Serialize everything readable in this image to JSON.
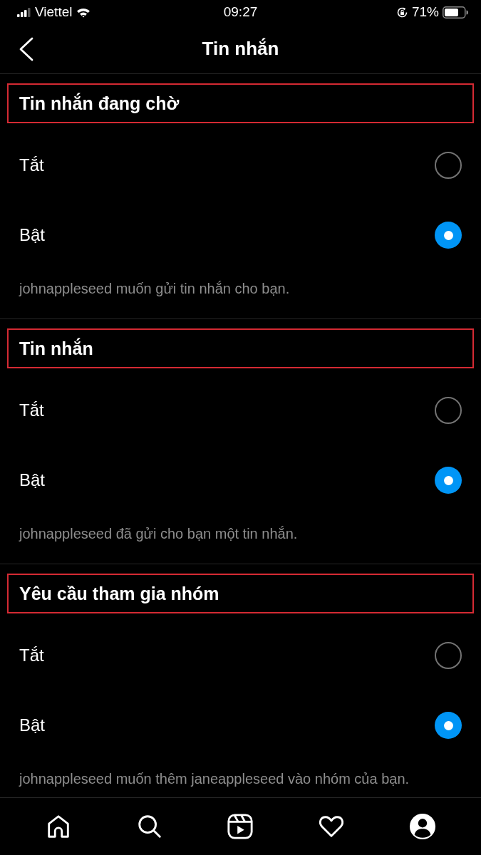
{
  "status_bar": {
    "carrier": "Viettel",
    "time": "09:27",
    "battery": "71%"
  },
  "header": {
    "title": "Tin nhắn"
  },
  "sections": [
    {
      "title": "Tin nhắn đang chờ",
      "highlighted": true,
      "options": [
        {
          "label": "Tắt",
          "selected": false
        },
        {
          "label": "Bật",
          "selected": true
        }
      ],
      "caption": "johnappleseed muốn gửi tin nhắn cho bạn."
    },
    {
      "title": "Tin nhắn",
      "highlighted": true,
      "options": [
        {
          "label": "Tắt",
          "selected": false
        },
        {
          "label": "Bật",
          "selected": true
        }
      ],
      "caption": "johnappleseed đã gửi cho bạn một tin nhắn."
    },
    {
      "title": "Yêu cầu tham gia nhóm",
      "highlighted": true,
      "options": [
        {
          "label": "Tắt",
          "selected": false
        },
        {
          "label": "Bật",
          "selected": true
        }
      ],
      "caption": "johnappleseed muốn thêm janeappleseed vào nhóm của bạn."
    }
  ],
  "tab_bar": [
    {
      "kind": "home"
    },
    {
      "kind": "search"
    },
    {
      "kind": "video"
    },
    {
      "kind": "heart"
    },
    {
      "kind": "profile"
    }
  ]
}
